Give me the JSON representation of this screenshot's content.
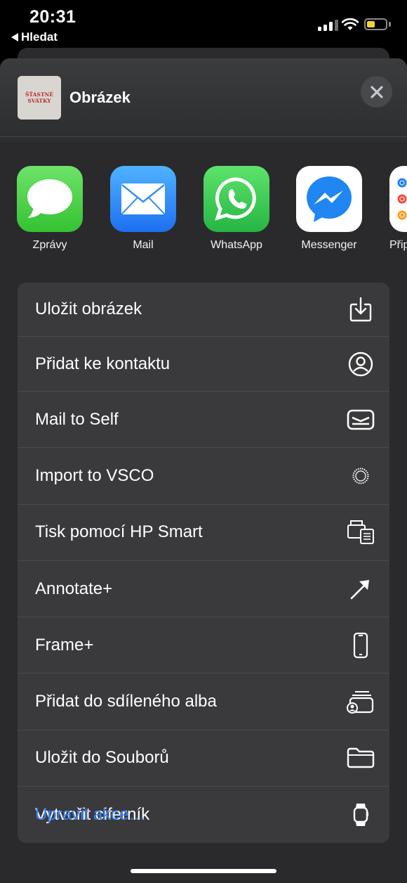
{
  "status_bar": {
    "time": "20:31",
    "back_label": "Hledat"
  },
  "header": {
    "title": "Obrázek",
    "thumbnail_text": "ŠŤASTNÉ SVÁTKY"
  },
  "apps": [
    {
      "label": "Zprávy",
      "icon": "messages-icon"
    },
    {
      "label": "Mail",
      "icon": "mail-icon"
    },
    {
      "label": "WhatsApp",
      "icon": "whatsapp-icon"
    },
    {
      "label": "Messenger",
      "icon": "messenger-icon"
    },
    {
      "label": "Přip",
      "icon": "reminders-icon"
    }
  ],
  "actions": [
    {
      "label": "Uložit obrázek",
      "icon": "save-download-icon"
    },
    {
      "label": "Přidat ke kontaktu",
      "icon": "contact-person-icon"
    },
    {
      "label": "Mail to Self",
      "icon": "mail-to-self-icon"
    },
    {
      "label": "Import to VSCO",
      "icon": "vsco-icon"
    },
    {
      "label": "Tisk pomocí HP Smart",
      "icon": "printer-icon"
    },
    {
      "label": "Annotate+",
      "icon": "arrow-icon"
    },
    {
      "label": "Frame+",
      "icon": "phone-icon"
    },
    {
      "label": "Přidat do sdíleného alba",
      "icon": "shared-album-icon"
    },
    {
      "label": "Uložit do Souborů",
      "icon": "folder-icon"
    },
    {
      "label": "Vytvořit ciferník",
      "icon": "watch-icon"
    }
  ],
  "footer": {
    "edit_label": "Upravit akce…"
  },
  "colors": {
    "accent": "#3b82f6",
    "sheet": "#2a2a2c",
    "row": "#3a3a3c"
  }
}
